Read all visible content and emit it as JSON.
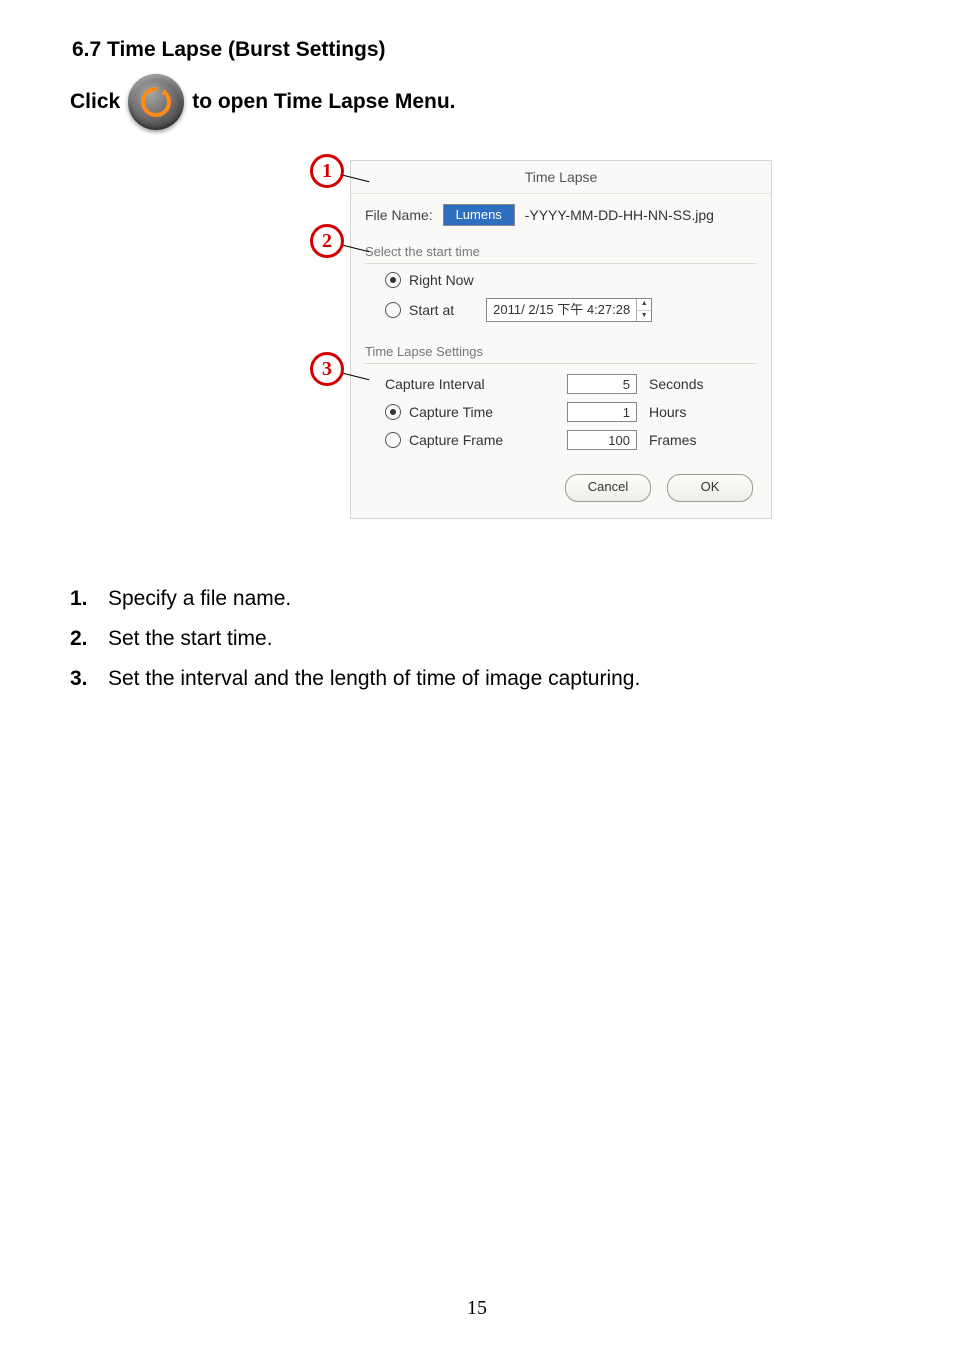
{
  "heading": "6.7  Time Lapse (Burst Settings)",
  "click_line": {
    "before": "Click",
    "after": " to open Time Lapse Menu."
  },
  "markers": {
    "m1": "1",
    "m2": "2",
    "m3": "3"
  },
  "dialog": {
    "title": "Time Lapse",
    "file_label": "File Name:",
    "file_value": "Lumens",
    "file_suffix": "-YYYY-MM-DD-HH-NN-SS.jpg",
    "group_start": "Select the start time",
    "right_now": "Right Now",
    "start_at": "Start at",
    "start_value": "2011/  2/15 下午   4:27:28",
    "group_settings": "Time Lapse Settings",
    "rows": {
      "interval": {
        "label": "Capture Interval",
        "value": "5",
        "unit": "Seconds"
      },
      "time": {
        "label": "Capture Time",
        "value": "1",
        "unit": "Hours"
      },
      "frame": {
        "label": "Capture Frame",
        "value": "100",
        "unit": "Frames"
      }
    },
    "buttons": {
      "cancel": "Cancel",
      "ok": "OK"
    }
  },
  "steps": {
    "s1": {
      "num": "1.",
      "text": "Specify a file name."
    },
    "s2": {
      "num": "2.",
      "text": "Set the start time."
    },
    "s3": {
      "num": "3.",
      "text": "Set the interval and the length of time of image capturing."
    }
  },
  "page_number": "15"
}
